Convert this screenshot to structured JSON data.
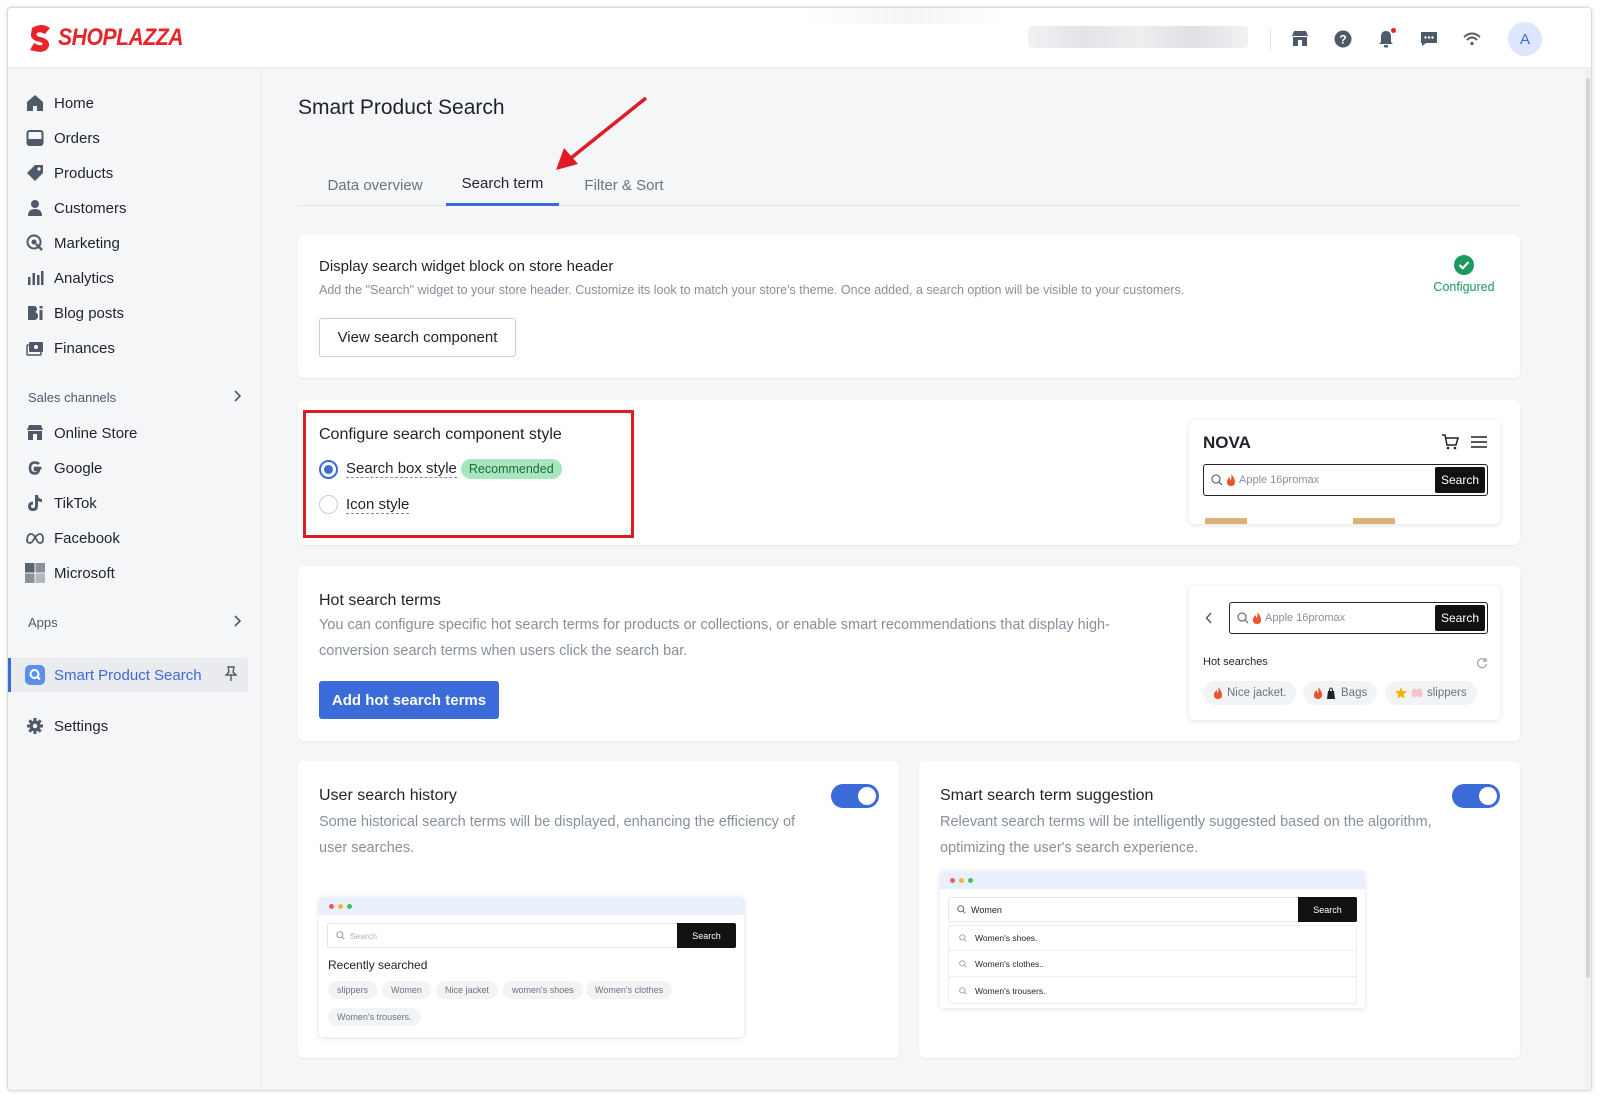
{
  "brand": {
    "name": "SHOPLAZZA",
    "color": "#e8242b"
  },
  "accent_color": "#3b6ad9",
  "header": {
    "avatar_initial": "A",
    "icons": [
      "store-icon",
      "help-icon",
      "bell-icon",
      "message-icon",
      "wifi-icon"
    ]
  },
  "sidebar": {
    "items": [
      {
        "label": "Home",
        "icon": "home-icon"
      },
      {
        "label": "Orders",
        "icon": "orders-icon"
      },
      {
        "label": "Products",
        "icon": "tag-icon"
      },
      {
        "label": "Customers",
        "icon": "user-icon"
      },
      {
        "label": "Marketing",
        "icon": "marketing-icon"
      },
      {
        "label": "Analytics",
        "icon": "bar-chart-icon"
      },
      {
        "label": "Blog posts",
        "icon": "blog-icon"
      },
      {
        "label": "Finances",
        "icon": "finance-icon"
      }
    ],
    "sales_channels_label": "Sales channels",
    "channels": [
      {
        "label": "Online Store",
        "icon": "store-icon"
      },
      {
        "label": "Google",
        "icon": "google-icon"
      },
      {
        "label": "TikTok",
        "icon": "tiktok-icon"
      },
      {
        "label": "Facebook",
        "icon": "meta-icon"
      },
      {
        "label": "Microsoft",
        "icon": "microsoft-icon"
      }
    ],
    "apps_label": "Apps",
    "active_app": "Smart Product Search",
    "settings_label": "Settings"
  },
  "main": {
    "title": "Smart Product Search",
    "tabs": [
      {
        "label": "Data overview",
        "active": false
      },
      {
        "label": "Search term",
        "active": true
      },
      {
        "label": "Filter & Sort",
        "active": false
      }
    ],
    "widget_card": {
      "title": "Display search widget block on store header",
      "description": "Add the \"Search\" widget to your store header. Customize its look to match your store's theme. Once added, a search option will be visible to your customers.",
      "button": "View search component",
      "status": "Configured",
      "status_color": "#1a9a5c"
    },
    "style_card": {
      "title": "Configure search component style",
      "option1": "Search box style",
      "option1_badge": "Recommended",
      "option2": "Icon style",
      "selected": "Search box style",
      "preview": {
        "store_name": "NOVA",
        "query": "Apple 16promax",
        "button": "Search"
      }
    },
    "hot_card": {
      "title": "Hot search terms",
      "description": "You can configure specific hot search terms for products or collections, or enable smart recommendations that display high-conversion search terms when users click the search bar.",
      "button": "Add hot search terms",
      "preview": {
        "query": "Apple 16promax",
        "button": "Search",
        "heading": "Hot searches",
        "chips": [
          "Nice jacket.",
          "Bags",
          "slippers"
        ]
      }
    },
    "history_card": {
      "title": "User search history",
      "description": "Some historical search terms will be displayed, enhancing the efficiency of user searches.",
      "enabled": true,
      "preview": {
        "placeholder": "Search",
        "button": "Search",
        "heading": "Recently searched",
        "chips": [
          "slippers",
          "Women",
          "Nice jacket",
          "women's shoes",
          "Women's  clothes",
          "Women's  trousers."
        ]
      }
    },
    "suggest_card": {
      "title": "Smart search term suggestion",
      "description": "Relevant search terms will be intelligently suggested based on the algorithm, optimizing the user's search experience.",
      "enabled": true,
      "preview": {
        "query": "Women",
        "button": "Search",
        "suggestions": [
          "Women's shoes.",
          "Women's  clothes..",
          "Women's  trousers."
        ]
      }
    }
  }
}
